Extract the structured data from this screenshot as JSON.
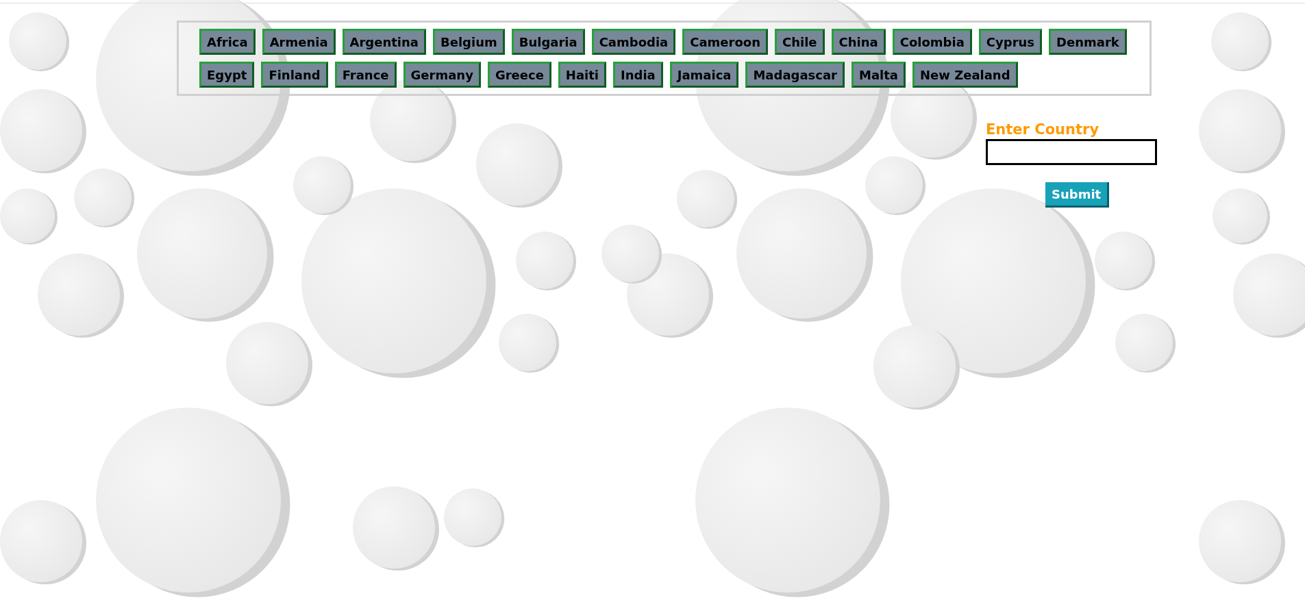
{
  "countries": [
    "Africa",
    "Armenia",
    "Argentina",
    "Belgium",
    "Bulgaria",
    "Cambodia",
    "Cameroon",
    "Chile",
    "China",
    "Colombia",
    "Cyprus",
    "Denmark",
    "Egypt",
    "Finland",
    "France",
    "Germany",
    "Greece",
    "Haiti",
    "India",
    "Jamaica",
    "Madagascar",
    "Malta",
    "New Zealand"
  ],
  "form": {
    "label": "Enter Country",
    "submit": "Submit"
  }
}
